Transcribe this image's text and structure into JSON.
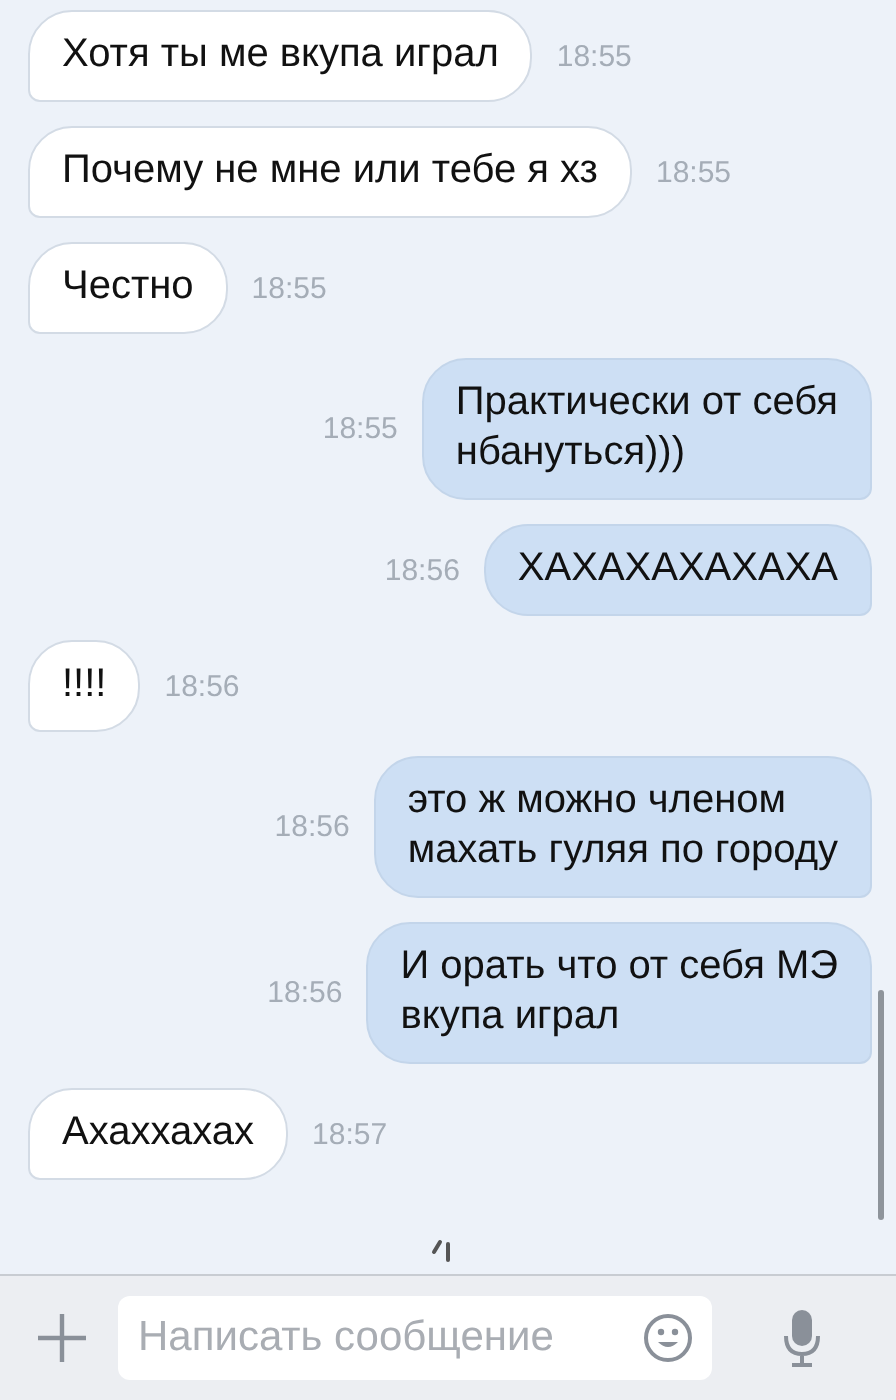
{
  "messages": [
    {
      "kind": "incoming",
      "text": "Хотя ты ме вкупа играл",
      "time": "18:55"
    },
    {
      "kind": "incoming",
      "text": "Почему не мне или тебе я хз",
      "time": "18:55"
    },
    {
      "kind": "incoming",
      "text": "Честно",
      "time": "18:55"
    },
    {
      "kind": "outgoing",
      "text": "Практически от себя\nнбануться)))",
      "time": "18:55"
    },
    {
      "kind": "outgoing",
      "text": "ХАХАХАХАХАХА",
      "time": "18:56"
    },
    {
      "kind": "incoming",
      "text": "!!!!",
      "time": "18:56"
    },
    {
      "kind": "outgoing",
      "text": "это ж можно членом\nмахать гуляя по городу",
      "time": "18:56"
    },
    {
      "kind": "outgoing",
      "text": "И орать что от себя МЭ\nвкупа играл",
      "time": "18:56"
    },
    {
      "kind": "incoming",
      "text": "Ахаххахах",
      "time": "18:57"
    }
  ],
  "composer": {
    "placeholder": "Написать сообщение"
  }
}
